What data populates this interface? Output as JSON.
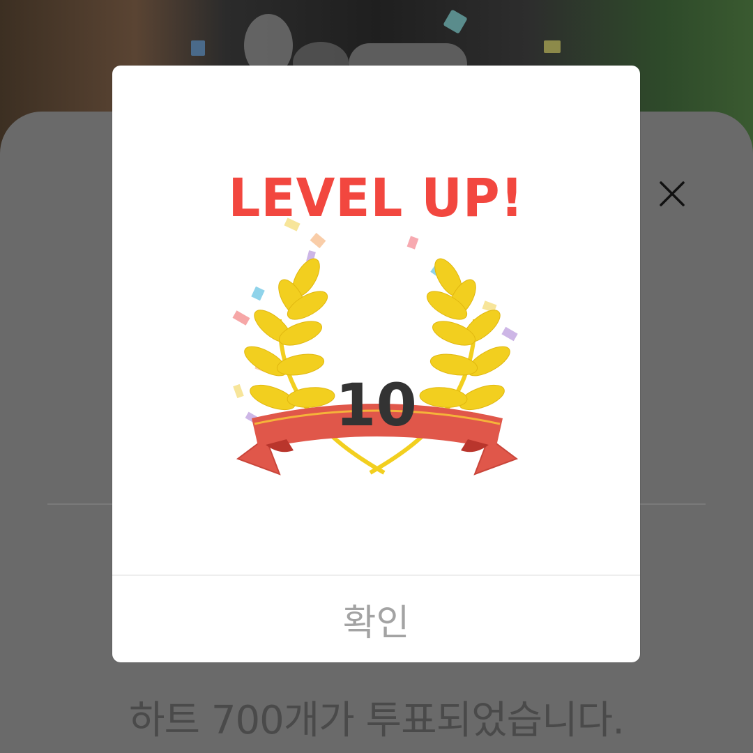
{
  "modal": {
    "title": "LEVEL UP!",
    "level": "10",
    "confirm_label": "확인"
  },
  "sheet": {
    "message": "하트 700개가 투표되었습니다.",
    "close_icon": "close-icon"
  },
  "colors": {
    "title_red": "#f2473f",
    "laurel_yellow": "#f2cf1f",
    "ribbon_red": "#e0574a",
    "overlay_gray": "#6a6a6a"
  }
}
